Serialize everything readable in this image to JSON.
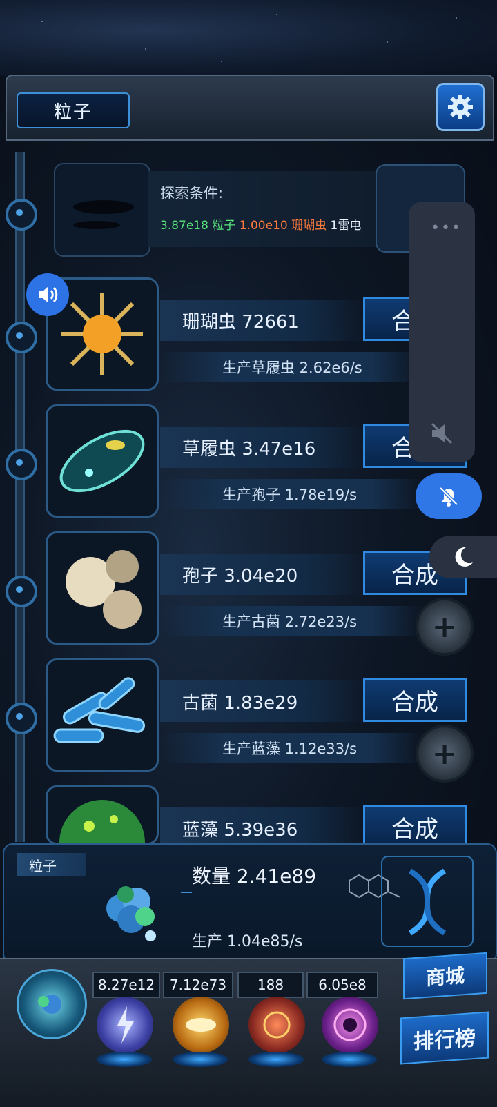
{
  "header": {
    "title": "粒子"
  },
  "locked": {
    "condition_label": "探索条件:",
    "req1": "3.87e18 粒子",
    "req2": "1.00e10 珊瑚虫",
    "req3": "1雷电"
  },
  "items": [
    {
      "name": "珊瑚虫 72661",
      "production": "生产草履虫 2.62e6/s",
      "button": "合成"
    },
    {
      "name": "草履虫 3.47e16",
      "production": "生产孢子 1.78e19/s",
      "button": "合成"
    },
    {
      "name": "孢子 3.04e20",
      "production": "生产古菌 2.72e23/s",
      "button": "合成"
    },
    {
      "name": "古菌 1.83e29",
      "production": "生产蓝藻 1.12e33/s",
      "button": "合成"
    },
    {
      "name": "蓝藻 5.39e36",
      "button": "合成"
    }
  ],
  "info": {
    "tag": "粒子",
    "count": "数量 2.41e89",
    "production": "生产 1.04e85/s"
  },
  "resources": [
    "8.27e12",
    "7.12e73",
    "188",
    "6.05e8"
  ],
  "buttons": {
    "shop": "商城",
    "rank": "排行榜"
  },
  "colors": {
    "green": "#58e37a",
    "orange": "#ff7a3c",
    "accent": "#2f8ae0"
  }
}
